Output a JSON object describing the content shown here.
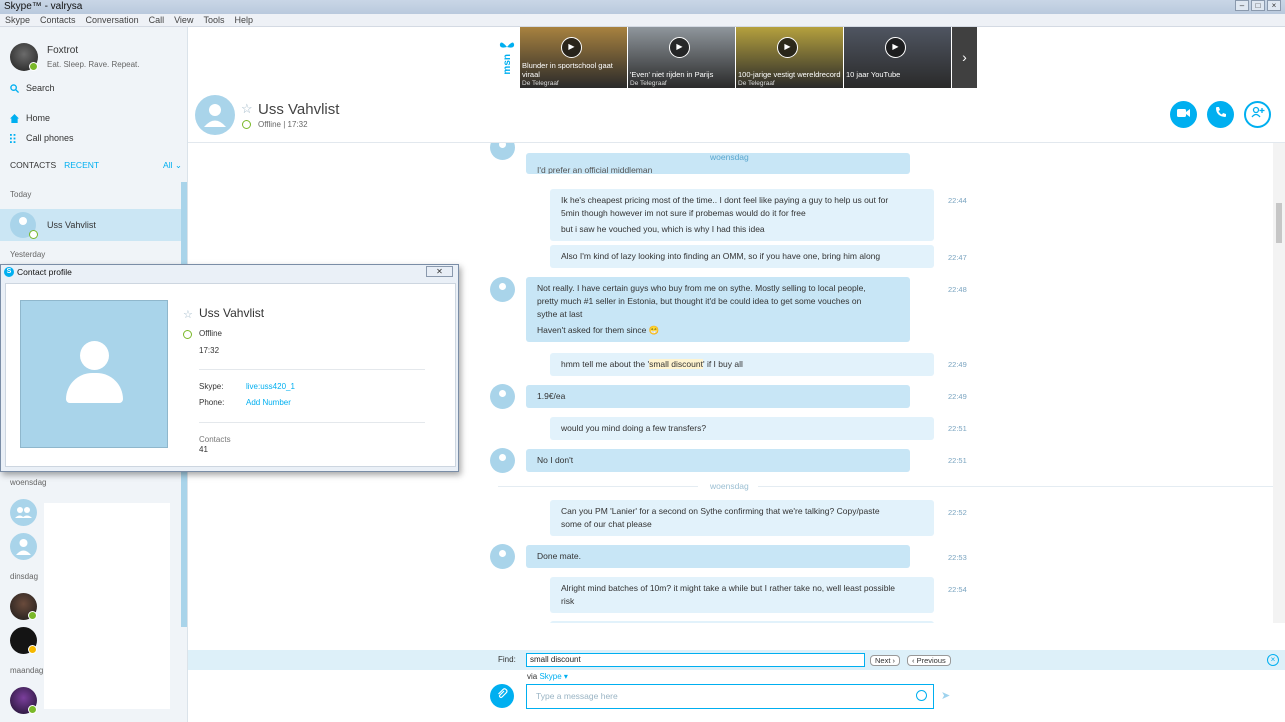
{
  "window": {
    "title": "Skype™ - valrysa"
  },
  "menu": [
    "Skype",
    "Contacts",
    "Conversation",
    "Call",
    "View",
    "Tools",
    "Help"
  ],
  "me": {
    "name": "Foxtrot",
    "mood": "Eat. Sleep. Rave. Repeat."
  },
  "sidebar": {
    "search": "Search",
    "home": "Home",
    "call_phones": "Call phones",
    "tab_contacts": "CONTACTS",
    "tab_recent": "RECENT",
    "filter": "All",
    "groups": {
      "today": "Today",
      "yesterday": "Yesterday",
      "woensdag": "woensdag",
      "dinsdag": "dinsdag",
      "maandag": "maandag"
    },
    "selected_contact": "Uss Vahvlist"
  },
  "news": {
    "brand": "msn",
    "tiles": [
      {
        "caption": "Blunder in sportschool gaat viraal",
        "source": "De Telegraaf",
        "bg": "#a8823f"
      },
      {
        "caption": "'Even' niet rijden in Parijs",
        "source": "De Telegraaf",
        "bg": "#8f969c"
      },
      {
        "caption": "100-jarige vestigt wereldrecord",
        "source": "De Telegraaf",
        "bg": "#b5a13e"
      },
      {
        "caption": "10 jaar YouTube",
        "source": "",
        "bg": "#4f5561"
      }
    ]
  },
  "chat": {
    "contact_name": "Uss Vahvlist",
    "status": "Offline | 17:32",
    "day_top": "woensdag",
    "day_mid": "woensdag",
    "partial_top": "I'd prefer an official middleman",
    "messages": [
      {
        "dir": "out",
        "lines": [
          "Ik he's cheapest pricing most of the time.. I dont feel like paying a guy to help us out for",
          "5min though however im not sure if probemas would do it for free"
        ],
        "time": "22:44"
      },
      {
        "dir": "out",
        "lines": [
          "but i saw he vouched you, which is why I had this idea"
        ],
        "time": ""
      },
      {
        "dir": "out",
        "lines": [
          "Also I'm kind of lazy looking into finding an OMM, so if you have one, bring him along"
        ],
        "time": "22:47"
      },
      {
        "dir": "in",
        "lines": [
          "Not really. I have certain guys who buy from me on sythe. Mostly selling to local people,",
          "pretty much #1 seller in Estonia, but thought it'd be could idea to get some vouches on",
          "sythe at last"
        ],
        "time": "22:48"
      },
      {
        "dir": "in",
        "lines": [
          "Haven't asked for them since 😁"
        ],
        "time": ""
      },
      {
        "dir": "out",
        "pre": "hmm tell me about the '",
        "highlight": "small discount",
        "post": "' if I buy all",
        "time": "22:49"
      },
      {
        "dir": "in",
        "lines": [
          "1.9€/ea"
        ],
        "time": "22:49"
      },
      {
        "dir": "out",
        "lines": [
          "would you mind doing a few transfers?"
        ],
        "time": "22:51"
      },
      {
        "dir": "in",
        "lines": [
          "No I don't"
        ],
        "time": "22:51"
      },
      {
        "dir": "out",
        "lines": [
          "Can you PM 'Lanier' for a second on Sythe confirming that we're talking? Copy/paste",
          "some of our chat please"
        ],
        "time": "22:52"
      },
      {
        "dir": "in",
        "lines": [
          "Done mate."
        ],
        "time": "22:53"
      },
      {
        "dir": "out",
        "lines": [
          "Alright mind batches of 10m? it might take a while but I rather take no, well least possible",
          "risk"
        ],
        "time": "22:54"
      }
    ]
  },
  "find": {
    "label": "Find:",
    "value": "small discount",
    "next": "Next ›",
    "previous": "‹ Previous"
  },
  "compose": {
    "via_label": "via",
    "via_value": "Skype ▾",
    "placeholder": "Type a message here"
  },
  "profile_window": {
    "title": "Contact profile",
    "name": "Uss Vahvlist",
    "status": "Offline",
    "time": "17:32",
    "skype_label": "Skype:",
    "skype_value": "live:uss420_1",
    "phone_label": "Phone:",
    "phone_value": "Add Number",
    "contacts_label": "Contacts",
    "contacts_value": "41"
  },
  "colors": {
    "accent": "#00aff0",
    "online": "#7ab829",
    "bubble_in": "#c8e6f6",
    "bubble_out": "#e2f2fb"
  }
}
